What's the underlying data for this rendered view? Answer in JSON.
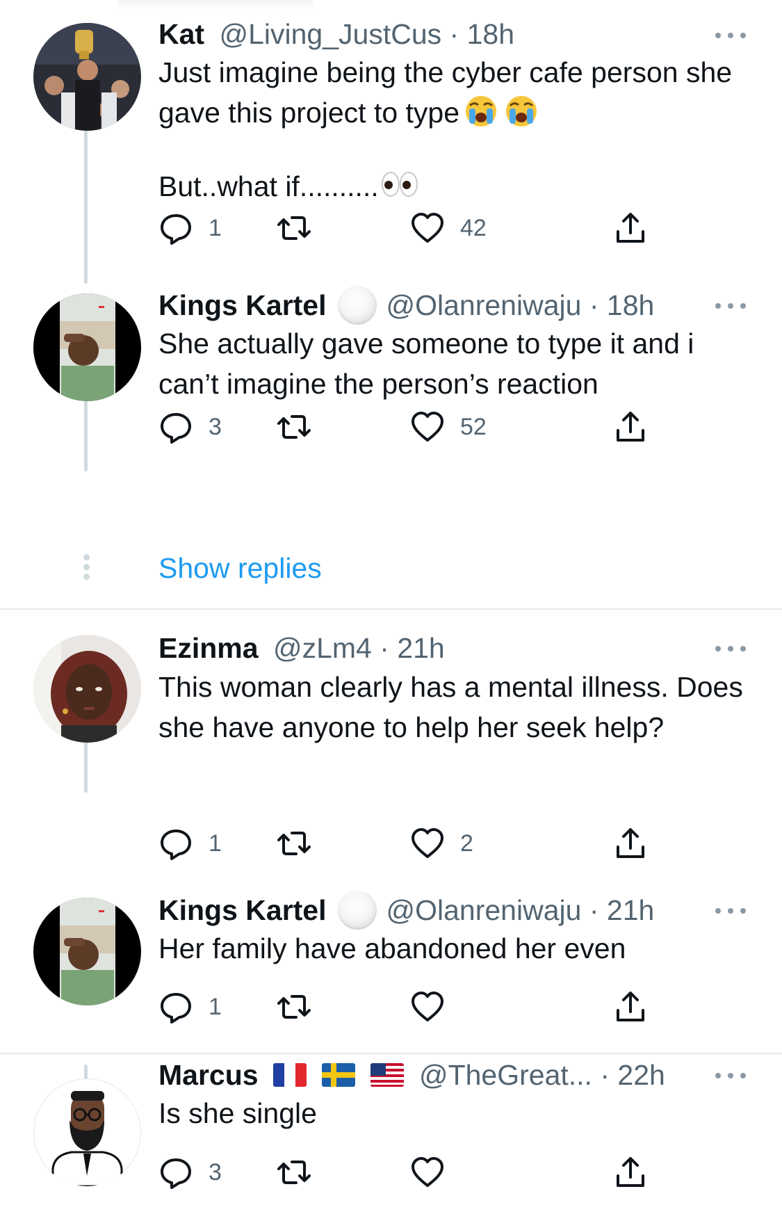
{
  "tweets": [
    {
      "name": "Kat",
      "handle": "@Living_JustCus",
      "separator": "·",
      "time": "18h",
      "text_lines": [
        "Just imagine being the cyber cafe person she gave this project to type",
        "",
        "But..what if.........."
      ],
      "emoji_line1": [
        "loudly-crying-face-emoji",
        "loudly-crying-face-emoji"
      ],
      "emoji_line2": [
        "eyes-emoji"
      ],
      "replies": "1",
      "retweets": "",
      "likes": "42"
    },
    {
      "name": "Kings Kartel",
      "handle": "@Olanreniwaju",
      "separator": "·",
      "time": "18h",
      "badge": "white-circle-emoji",
      "text": "She actually gave someone to type it and i can’t imagine the person’s reaction",
      "replies": "3",
      "retweets": "",
      "likes": "52"
    },
    {
      "name": "Ezinma",
      "handle": "@zLm4",
      "separator": "·",
      "time": "21h",
      "text": "This woman clearly has a mental illness. Does she have anyone to help her seek help?",
      "replies": "1",
      "retweets": "",
      "likes": "2"
    },
    {
      "name": "Kings Kartel",
      "handle": "@Olanreniwaju",
      "separator": "·",
      "time": "21h",
      "badge": "white-circle-emoji",
      "text": "Her family have abandoned her even",
      "replies": "1",
      "retweets": "",
      "likes": ""
    },
    {
      "name": "Marcus",
      "flags": [
        "france-flag",
        "sweden-flag",
        "usa-flag"
      ],
      "handle": "@TheGreat...",
      "separator": "·",
      "time": "22h",
      "text": "Is she single",
      "replies": "3",
      "retweets": "",
      "likes": ""
    }
  ],
  "show_replies": "Show replies",
  "icons": {
    "reply": "reply-icon",
    "retweet": "retweet-icon",
    "like": "heart-icon",
    "share": "share-icon",
    "more": "more-icon"
  },
  "colors": {
    "link": "#1d9bf0",
    "secondary_text": "#536471",
    "thread_line": "#cfd9de",
    "divider": "#e6e9eb"
  }
}
